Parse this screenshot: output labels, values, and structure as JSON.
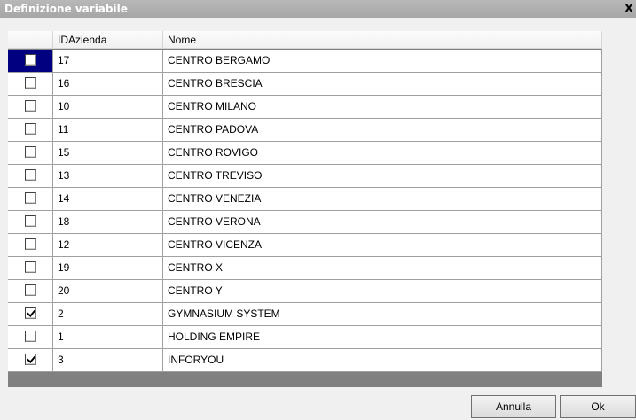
{
  "window": {
    "title": "Definizione variabile",
    "close_glyph": "x"
  },
  "grid": {
    "columns": [
      "",
      "IDAzienda",
      "Nome"
    ],
    "rows": [
      {
        "checked": false,
        "selected": true,
        "id": "17",
        "nome": "CENTRO BERGAMO"
      },
      {
        "checked": false,
        "selected": false,
        "id": "16",
        "nome": "CENTRO BRESCIA"
      },
      {
        "checked": false,
        "selected": false,
        "id": "10",
        "nome": "CENTRO MILANO"
      },
      {
        "checked": false,
        "selected": false,
        "id": "11",
        "nome": "CENTRO PADOVA"
      },
      {
        "checked": false,
        "selected": false,
        "id": "15",
        "nome": "CENTRO ROVIGO"
      },
      {
        "checked": false,
        "selected": false,
        "id": "13",
        "nome": "CENTRO TREVISO"
      },
      {
        "checked": false,
        "selected": false,
        "id": "14",
        "nome": "CENTRO VENEZIA"
      },
      {
        "checked": false,
        "selected": false,
        "id": "18",
        "nome": "CENTRO VERONA"
      },
      {
        "checked": false,
        "selected": false,
        "id": "12",
        "nome": "CENTRO VICENZA"
      },
      {
        "checked": false,
        "selected": false,
        "id": "19",
        "nome": "CENTRO X"
      },
      {
        "checked": false,
        "selected": false,
        "id": "20",
        "nome": "CENTRO Y"
      },
      {
        "checked": true,
        "selected": false,
        "id": "2",
        "nome": "GYMNASIUM SYSTEM"
      },
      {
        "checked": false,
        "selected": false,
        "id": "1",
        "nome": "HOLDING EMPIRE"
      },
      {
        "checked": true,
        "selected": false,
        "id": "3",
        "nome": "INFORYOU"
      }
    ]
  },
  "buttons": {
    "cancel_label": "Annulla",
    "ok_label": "Ok"
  }
}
